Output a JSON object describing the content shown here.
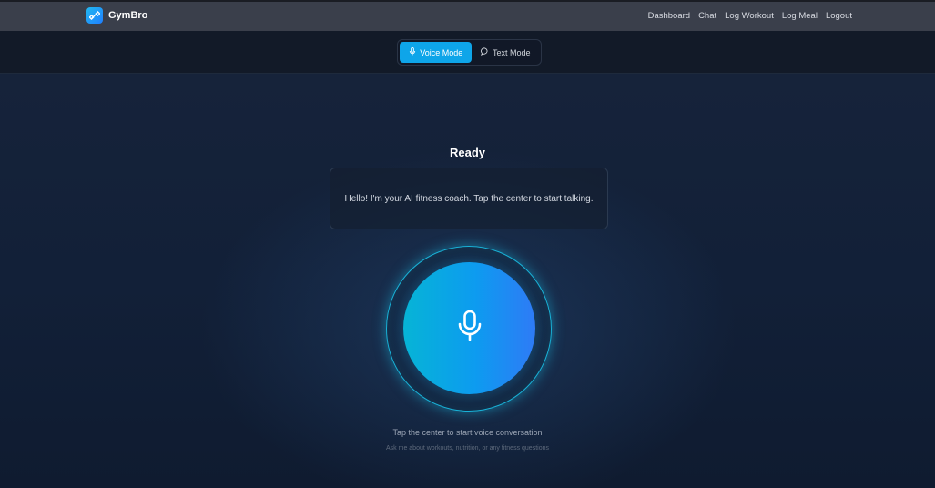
{
  "app": {
    "name": "GymBro",
    "logo_icon": "dumbbell-icon"
  },
  "nav": {
    "items": [
      {
        "label": "Dashboard"
      },
      {
        "label": "Chat"
      },
      {
        "label": "Log Workout"
      },
      {
        "label": "Log Meal"
      },
      {
        "label": "Logout"
      }
    ]
  },
  "modes": {
    "voice": {
      "label": "Voice Mode",
      "icon": "microphone-icon",
      "active": true
    },
    "text": {
      "label": "Text Mode",
      "icon": "chat-bubble-icon",
      "active": false
    }
  },
  "voice": {
    "status": "Ready",
    "message": "Hello! I'm your AI fitness coach. Tap the center to start talking.",
    "mic_icon": "microphone-icon",
    "hint": "Tap the center to start voice conversation",
    "subhint": "Ask me about workouts, nutrition, or any fitness questions"
  },
  "colors": {
    "accent": "#0ea5e9",
    "navbar": "#3a3f4b",
    "background": "#0f1a2e",
    "ring": "#1ab3d8"
  }
}
